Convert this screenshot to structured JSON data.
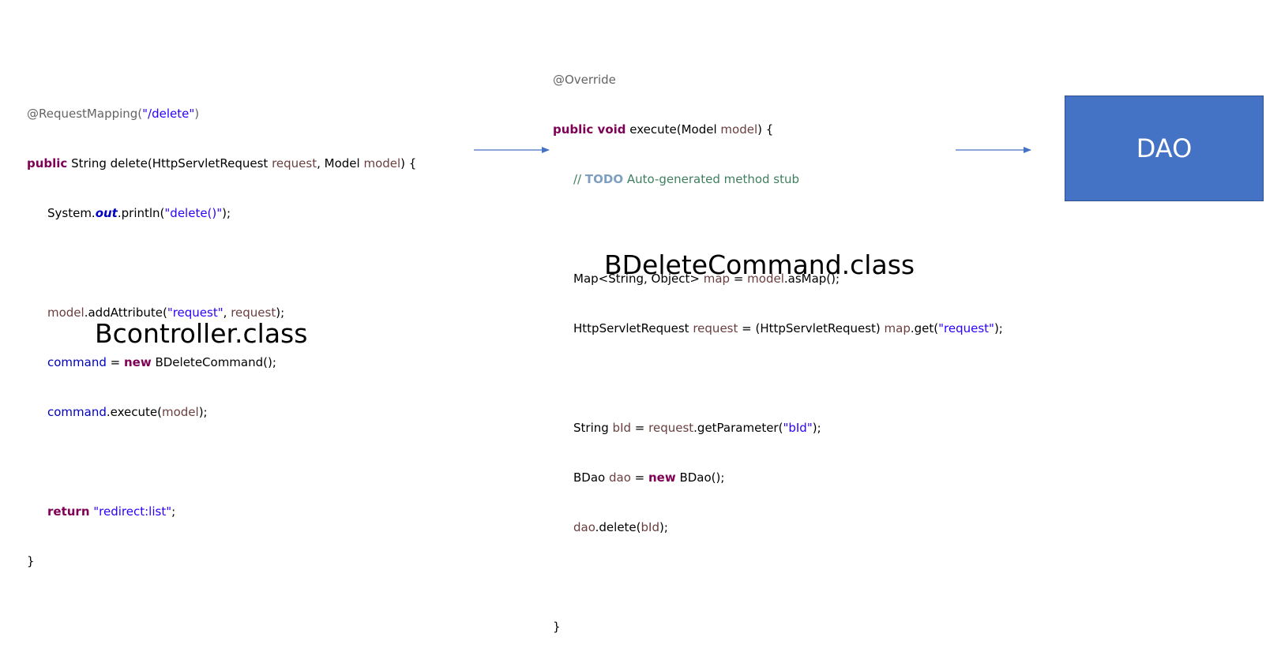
{
  "colors": {
    "annotation": "#646464",
    "keyword": "#7f0055",
    "string": "#2a00ff",
    "variable": "#6a3e3e",
    "comment": "#3f7f5f",
    "todo": "#7f9fbf",
    "arrow": "#4472c4",
    "dao_box": "#4472c4"
  },
  "controller": {
    "caption": "Bcontroller.class",
    "code": {
      "l1_ann": "@RequestMapping(",
      "l1_str": "\"/delete\"",
      "l1_close": ")",
      "l2_kw": "public",
      "l2_a": " String delete(HttpServletRequest ",
      "l2_var1": "request",
      "l2_b": ", Model ",
      "l2_var2": "model",
      "l2_c": ") {",
      "l3_a": "System.",
      "l3_static": "out",
      "l3_b": ".println(",
      "l3_str": "\"delete()\"",
      "l3_c": ");",
      "l5_var1": "model",
      "l5_a": ".addAttribute(",
      "l5_str": "\"request\"",
      "l5_b": ", ",
      "l5_var2": "request",
      "l5_c": ");",
      "l6_field": "command",
      "l6_a": " = ",
      "l6_kw": "new",
      "l6_b": " BDeleteCommand();",
      "l7_field": "command",
      "l7_a": ".execute(",
      "l7_var": "model",
      "l7_b": ");",
      "l9_kw": "return",
      "l9_a": " ",
      "l9_str": "\"redirect:list\"",
      "l9_b": ";",
      "l10": "}"
    }
  },
  "command": {
    "caption": "BDeleteCommand.class",
    "code": {
      "l1_ann": "@Override",
      "l2_kw": "public void",
      "l2_a": " execute(Model ",
      "l2_var": "model",
      "l2_b": ") {",
      "l3_comment1": "// ",
      "l3_todo": "TODO",
      "l3_comment2": " Auto-generated method stub",
      "l5_a": "Map<String, Object> ",
      "l5_var1": "map",
      "l5_b": " = ",
      "l5_var2": "model",
      "l5_c": ".asMap();",
      "l6_a": "HttpServletRequest ",
      "l6_var1": "request",
      "l6_b": " = (HttpServletRequest) ",
      "l6_var2": "map",
      "l6_c": ".get(",
      "l6_str": "\"request\"",
      "l6_d": ");",
      "l8_a": "String ",
      "l8_var1": "bId",
      "l8_b": " = ",
      "l8_var2": "request",
      "l8_c": ".getParameter(",
      "l8_str": "\"bId\"",
      "l8_d": ");",
      "l9_a": "BDao ",
      "l9_var": "dao",
      "l9_b": " = ",
      "l9_kw": "new",
      "l9_c": " BDao();",
      "l10_var1": "dao",
      "l10_a": ".delete(",
      "l10_var2": "bId",
      "l10_b": ");",
      "l12": "}"
    }
  },
  "dao": {
    "label": "DAO"
  }
}
